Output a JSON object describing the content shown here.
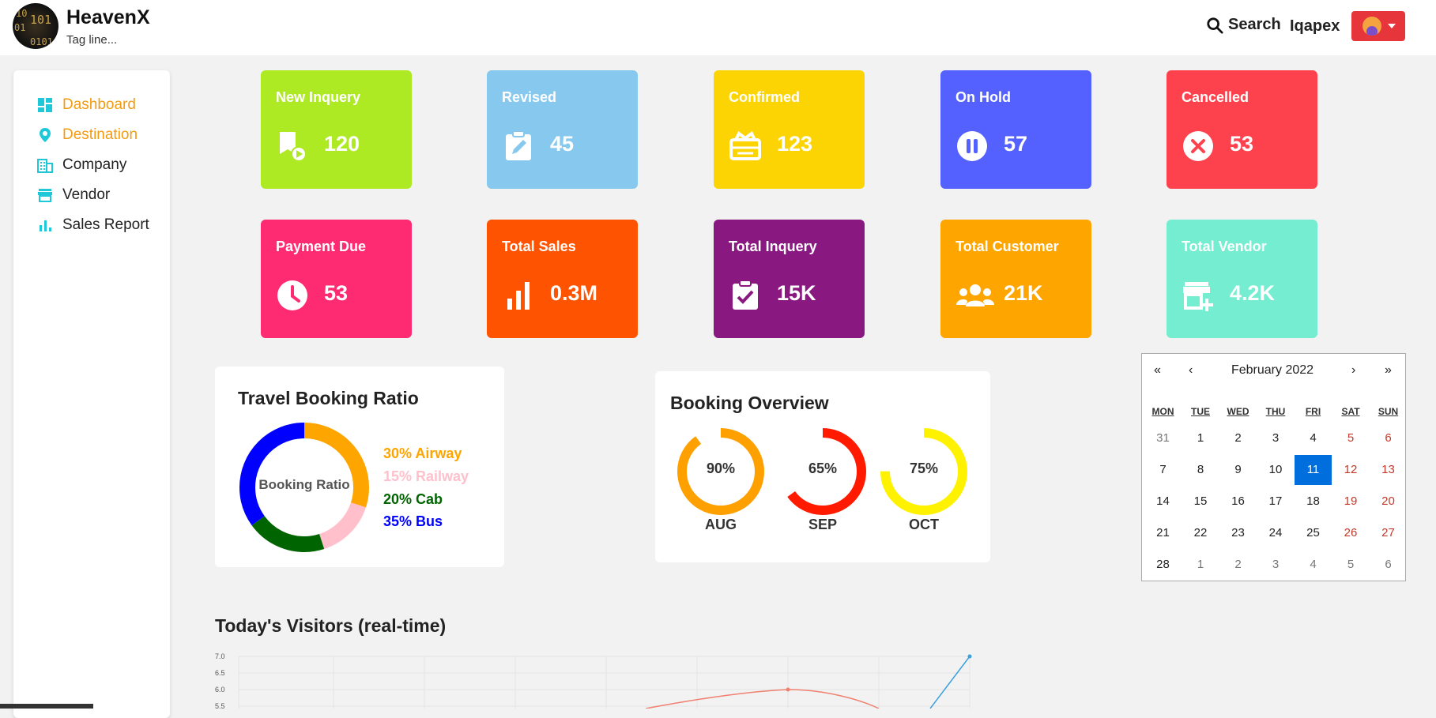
{
  "header": {
    "brand": "HeavenX",
    "tagline": "Tag line...",
    "search_label": "Search",
    "username": "Iqapex",
    "logo_text": [
      "10",
      "101",
      "01",
      "0101"
    ]
  },
  "sidebar": {
    "items": [
      {
        "label": "Dashboard",
        "icon": "dashboard-icon"
      },
      {
        "label": "Destination",
        "icon": "location-pin-icon"
      },
      {
        "label": "Company",
        "icon": "building-icon"
      },
      {
        "label": "Vendor",
        "icon": "store-icon"
      },
      {
        "label": "Sales Report",
        "icon": "bar-chart-icon"
      }
    ],
    "active_color": "#f39c12"
  },
  "cards": [
    {
      "title": "New Inquery",
      "value": "120",
      "color": "#aeea24",
      "icon": "bookmark-play-icon"
    },
    {
      "title": "Revised",
      "value": "45",
      "color": "#87c9ee",
      "icon": "clipboard-edit-icon"
    },
    {
      "title": "Confirmed",
      "value": "123",
      "color": "#fdd403",
      "icon": "ticket-icon"
    },
    {
      "title": "On Hold",
      "value": "57",
      "color": "#5561ff",
      "icon": "pause-circle-icon"
    },
    {
      "title": "Cancelled",
      "value": "53",
      "color": "#fe424d",
      "icon": "close-circle-icon"
    },
    {
      "title": "Payment Due",
      "value": "53",
      "color": "#fe2b73",
      "icon": "clock-icon"
    },
    {
      "title": "Total Sales",
      "value": "0.3M",
      "color": "#fe5300",
      "icon": "bar-chart-icon"
    },
    {
      "title": "Total Inquery",
      "value": "15K",
      "color": "#8a1881",
      "icon": "clipboard-check-icon"
    },
    {
      "title": "Total Customer",
      "value": "21K",
      "color": "#fea500",
      "icon": "users-icon"
    },
    {
      "title": "Total Vendor",
      "value": "4.2K",
      "color": "#74edd0",
      "icon": "store-add-icon"
    }
  ],
  "travel_ratio": {
    "title": "Travel Booking Ratio",
    "center_label": "Booking Ratio",
    "segments": [
      {
        "label": "30% Airway",
        "value": 30,
        "color": "#fea500"
      },
      {
        "label": "15% Railway",
        "value": 15,
        "color": "#ffc0cb"
      },
      {
        "label": "20% Cab",
        "value": 20,
        "color": "#006400"
      },
      {
        "label": "35% Bus",
        "value": 35,
        "color": "#0000ff"
      }
    ]
  },
  "booking_overview": {
    "title": "Booking Overview",
    "rings": [
      {
        "month": "AUG",
        "percent": 90,
        "label": "90%",
        "color": "#fea000"
      },
      {
        "month": "SEP",
        "percent": 65,
        "label": "65%",
        "color": "#ff1a00"
      },
      {
        "month": "OCT",
        "percent": 75,
        "label": "75%",
        "color": "#fff200"
      }
    ]
  },
  "calendar": {
    "prev_year": "«",
    "prev_month": "‹",
    "title": "February 2022",
    "next_month": "›",
    "next_year": "»",
    "weekdays": [
      "MON",
      "TUE",
      "WED",
      "THU",
      "FRI",
      "SAT",
      "SUN"
    ],
    "weeks": [
      [
        "31",
        "1",
        "2",
        "3",
        "4",
        "5",
        "6"
      ],
      [
        "7",
        "8",
        "9",
        "10",
        "11",
        "12",
        "13"
      ],
      [
        "14",
        "15",
        "16",
        "17",
        "18",
        "19",
        "20"
      ],
      [
        "21",
        "22",
        "23",
        "24",
        "25",
        "26",
        "27"
      ],
      [
        "28",
        "1",
        "2",
        "3",
        "4",
        "5",
        "6"
      ]
    ],
    "selected": "11"
  },
  "visitors": {
    "title": "Today's Visitors (real-time)",
    "y_ticks": [
      "7.0",
      "6.5",
      "6.0",
      "5.5"
    ]
  }
}
